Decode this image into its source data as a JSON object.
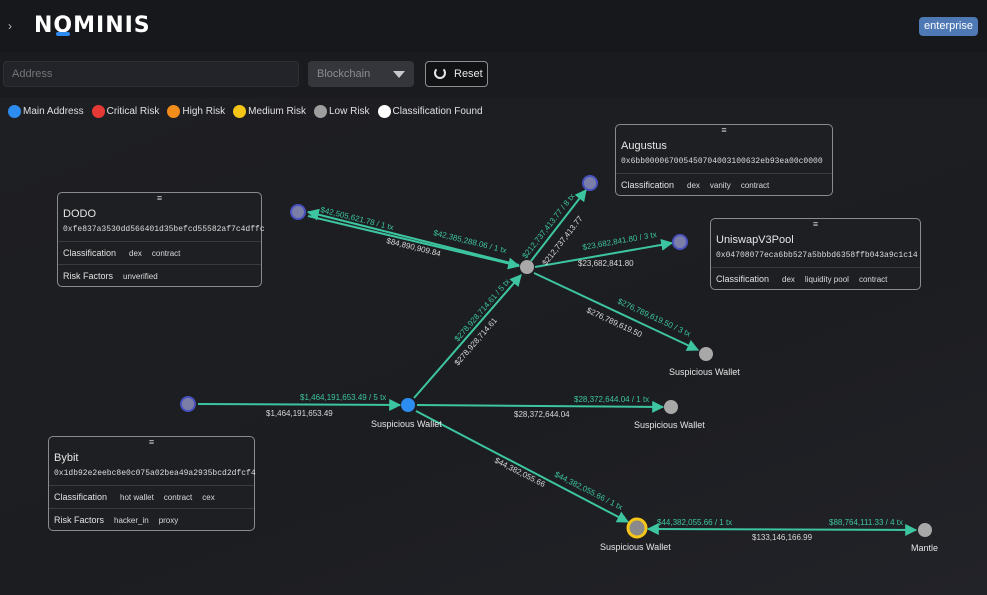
{
  "app": {
    "brand": "NOMINIS",
    "plan_badge": "enterprise"
  },
  "filters": {
    "address_placeholder": "Address",
    "blockchain_placeholder": "Blockchain",
    "reset_label": "Reset"
  },
  "legend": [
    {
      "label": "Main Address",
      "color": "#2d8cf0"
    },
    {
      "label": "Critical Risk",
      "color": "#e53935"
    },
    {
      "label": "High Risk",
      "color": "#f28c1b"
    },
    {
      "label": "Medium Risk",
      "color": "#f5c518"
    },
    {
      "label": "Low Risk",
      "color": "#9e9e9e"
    },
    {
      "label": "Classification Found",
      "color": "#ffffff"
    }
  ],
  "cards": {
    "dodo": {
      "name": "DODO",
      "address": "0xfe837a3530dd566401d35befcd55582af7c4dffc",
      "classification_label": "Classification",
      "classification": [
        "dex",
        "contract"
      ],
      "risk_label": "Risk Factors",
      "risk_factors": [
        "unverified"
      ]
    },
    "bybit": {
      "name": "Bybit",
      "address": "0x1db92e2eebc8e0c075a02bea49a2935bcd2dfcf4",
      "classification_label": "Classification",
      "classification": [
        "hot wallet",
        "contract",
        "cex"
      ],
      "risk_label": "Risk Factors",
      "risk_factors": [
        "hacker_in",
        "proxy"
      ]
    },
    "augustus": {
      "name": "Augustus",
      "address": "0x6bb000067005450704003100632eb93ea00c0000",
      "classification_label": "Classification",
      "classification": [
        "dex",
        "vanity",
        "contract"
      ]
    },
    "uniswap": {
      "name": "UniswapV3Pool",
      "address": "0x04708077eca6bb527a5bbbd6358ffb043a9c1c14",
      "classification_label": "Classification",
      "classification": [
        "dex",
        "liquidity pool",
        "contract"
      ]
    }
  },
  "node_labels": {
    "main": "Suspicious Wallet",
    "wallet_right_upper": "Suspicious Wallet",
    "wallet_right_mid": "Suspicious Wallet",
    "wallet_bottom": "Suspicious Wallet",
    "mantle": "Mantle"
  },
  "edges": {
    "bybit_to_main": {
      "top": "$1,464,191,653.49 / 5 tx",
      "bottom": "$1,464,191,653.49"
    },
    "main_to_mid": {
      "top": "$28,372,644.04 / 1 tx",
      "bottom": "$28,372,644.04"
    },
    "main_to_bottom": {
      "top": "$44,382,055.66 / 1 tx",
      "bottom": "$44,382,055.66"
    },
    "main_to_hub": {
      "top": "$278,928,714.61 / 5 tx",
      "bottom": "$278,928,714.61"
    },
    "hub_to_dodo": {
      "top": "$42,505,621.78 / 1 tx",
      "bottom": "$84,890,909.84"
    },
    "dodo_to_hub": {
      "top": "$42,385,288.06 / 1 tx"
    },
    "hub_to_augustus": {
      "top": "$212,737,413.77 / 8 tx",
      "bottom": "$212,737,413.77"
    },
    "hub_to_uniswap": {
      "top": "$23,682,841.80 / 3 tx",
      "bottom": "$23,682,841.80"
    },
    "hub_to_upper": {
      "top": "$276,789,619.50 / 3 tx",
      "bottom": "$276,789,619.50"
    },
    "bottom_to_mantle": {
      "left": "$44,382,055.66 / 1 tx",
      "right": "$88,764,111.33 / 4 tx",
      "bottom": "$133,146,166.99"
    }
  }
}
